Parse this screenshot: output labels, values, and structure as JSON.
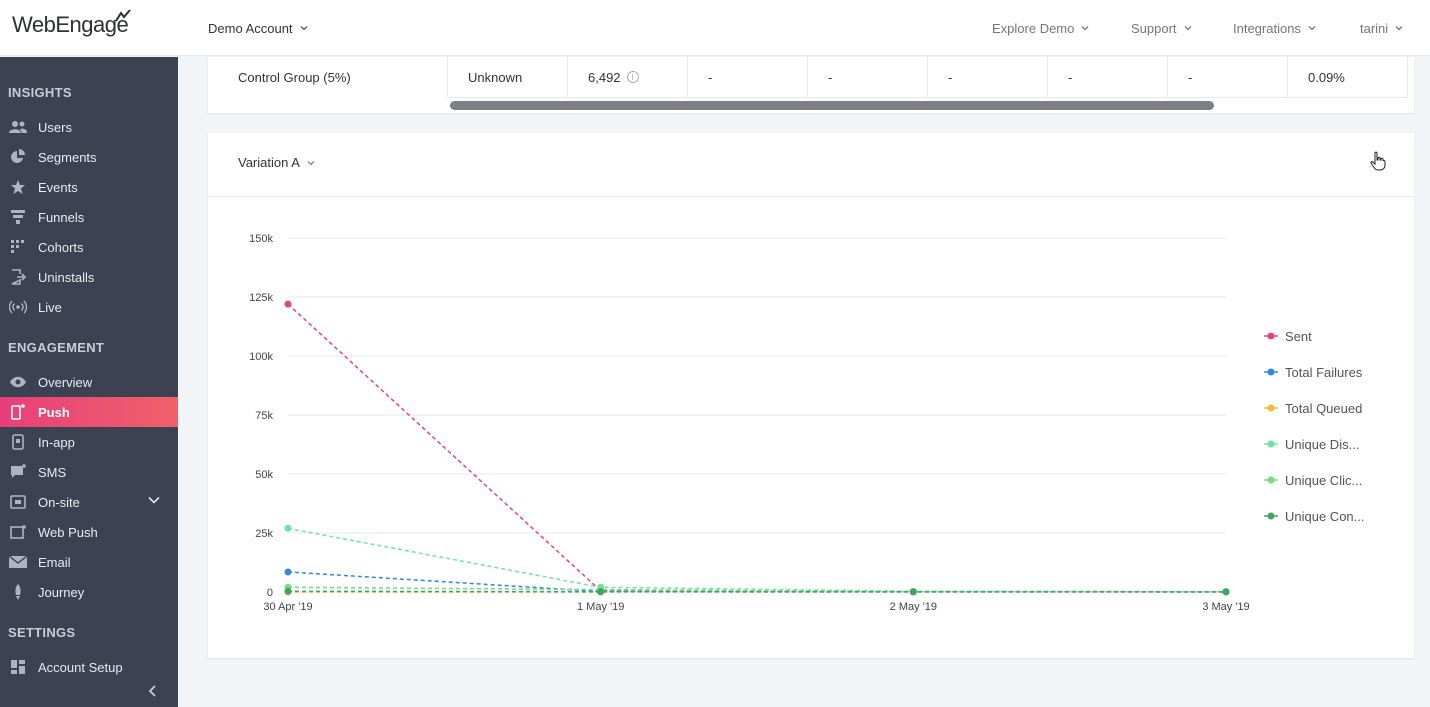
{
  "header": {
    "logo_text": "WebEngage",
    "account_menu": "Demo Account",
    "explore_demo": "Explore Demo",
    "support": "Support",
    "integrations": "Integrations",
    "user": "tarini"
  },
  "sidebar": {
    "sections": [
      {
        "title": "INSIGHTS"
      },
      {
        "title": "ENGAGEMENT"
      },
      {
        "title": "SETTINGS"
      }
    ],
    "items": [
      {
        "label": "Users",
        "icon": "users-icon"
      },
      {
        "label": "Segments",
        "icon": "pie-icon"
      },
      {
        "label": "Events",
        "icon": "star-icon"
      },
      {
        "label": "Funnels",
        "icon": "funnel-icon"
      },
      {
        "label": "Cohorts",
        "icon": "grid-icon"
      },
      {
        "label": "Uninstalls",
        "icon": "exit-icon"
      },
      {
        "label": "Live",
        "icon": "broadcast-icon"
      },
      {
        "label": "Overview",
        "icon": "eye-icon"
      },
      {
        "label": "Push",
        "icon": "mobile-icon"
      },
      {
        "label": "In-app",
        "icon": "inapp-icon"
      },
      {
        "label": "SMS",
        "icon": "chat-icon"
      },
      {
        "label": "On-site",
        "icon": "window-icon"
      },
      {
        "label": "Web Push",
        "icon": "browser-icon"
      },
      {
        "label": "Email",
        "icon": "envelope-icon"
      },
      {
        "label": "Journey",
        "icon": "rocket-icon"
      },
      {
        "label": "Account Setup",
        "icon": "dashboard-icon"
      }
    ],
    "active": "Push"
  },
  "table_row": {
    "label": "Control Group (5%)",
    "platform": "Unknown",
    "count": "6,492",
    "cells": [
      "-",
      "-",
      "-",
      "-",
      "-"
    ],
    "rate": "0.09%",
    "info": "i"
  },
  "chart_header": {
    "variation": "Variation A"
  },
  "colors": {
    "accent": "#e8407a",
    "sidebar_bg": "#3d4252"
  },
  "chart_data": {
    "type": "line",
    "categories": [
      "30 Apr '19",
      "1 May '19",
      "2 May '19",
      "3 May '19"
    ],
    "y_ticks": [
      "0",
      "25k",
      "50k",
      "75k",
      "100k",
      "125k",
      "150k"
    ],
    "ylim": [
      0,
      150000
    ],
    "grid": true,
    "legend_position": "right",
    "series": [
      {
        "name": "Sent",
        "color": "#e0457f",
        "values": [
          122000,
          500,
          200,
          100
        ]
      },
      {
        "name": "Total Failures",
        "color": "#2f86e6",
        "values": [
          8500,
          200,
          100,
          100
        ]
      },
      {
        "name": "Total Queued",
        "color": "#f5b935",
        "values": [
          0,
          0,
          0,
          0
        ]
      },
      {
        "name": "Unique Dis...",
        "color": "#6fe3a1",
        "values": [
          27000,
          2000,
          300,
          100
        ]
      },
      {
        "name": "Unique Clic...",
        "color": "#74dd7f",
        "values": [
          2000,
          1000,
          200,
          100
        ]
      },
      {
        "name": "Unique Con...",
        "color": "#3ea564",
        "values": [
          300,
          100,
          50,
          20
        ]
      }
    ]
  }
}
